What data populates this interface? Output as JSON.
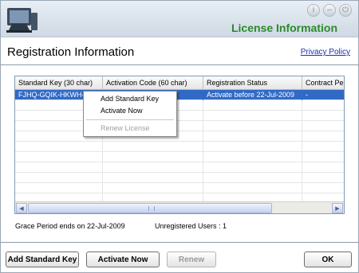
{
  "header": {
    "title": "License Information",
    "controls": [
      "info-icon",
      "minimize-icon",
      "power-icon"
    ]
  },
  "section": {
    "title": "Registration Information",
    "privacy_link": "Privacy Policy"
  },
  "grid": {
    "columns": [
      "Standard Key (30 char)",
      "Activation Code (60 char)",
      "Registration Status",
      "Contract Pe"
    ],
    "rows": [
      [
        "FJHQ-GQIK-HKWH-",
        "",
        "Activate before  22-Jul-2009",
        "-"
      ]
    ]
  },
  "context_menu": {
    "items": [
      "Add Standard Key",
      "Activate Now",
      "Renew License"
    ]
  },
  "status": {
    "grace_period": "Grace Period ends on 22-Jul-2009",
    "unregistered_users": "Unregistered Users : 1"
  },
  "buttons": {
    "add_standard_key": "Add Standard Key",
    "activate_now": "Activate Now",
    "renew": "Renew",
    "ok": "OK"
  },
  "colors": {
    "title_green": "#2a8a2a",
    "selection_blue": "#316ac5",
    "link_blue": "#1b2fb8"
  }
}
